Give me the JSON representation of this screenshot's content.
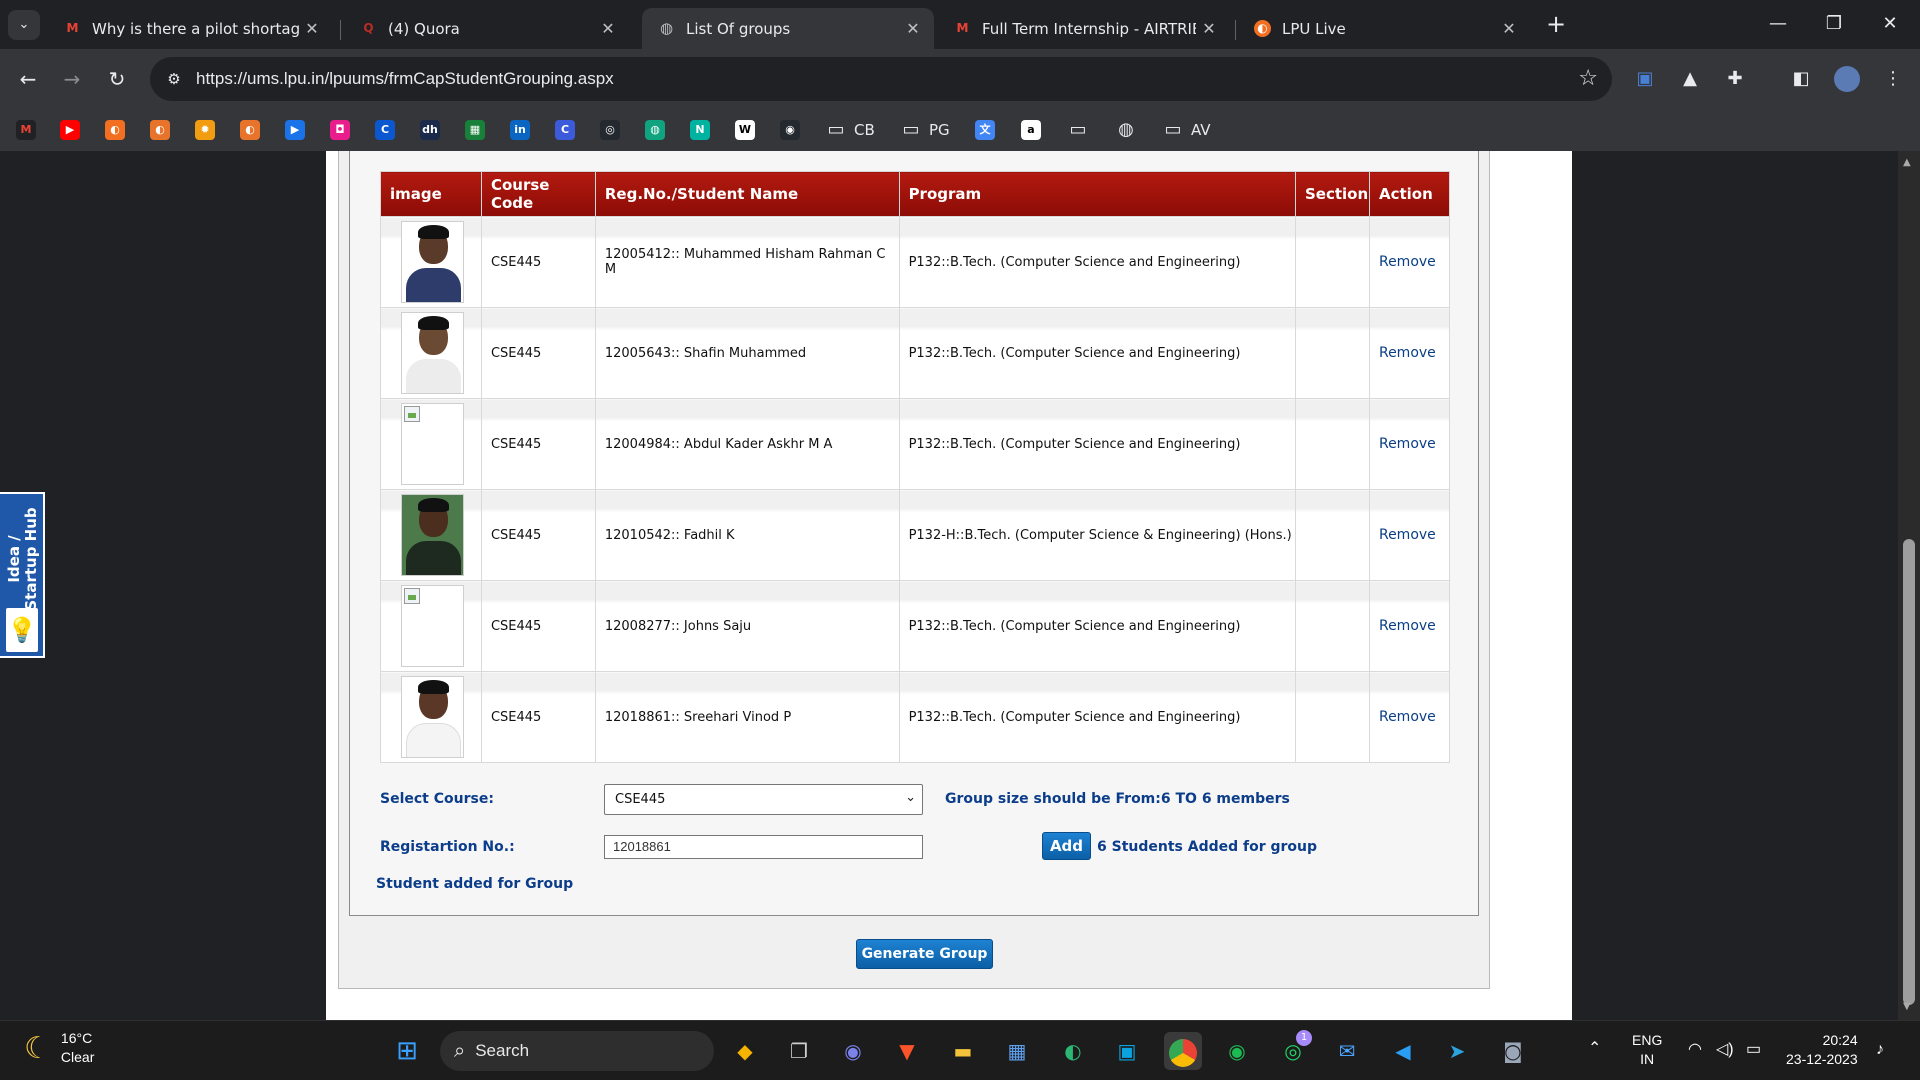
{
  "browser": {
    "tabs": [
      {
        "title": "Why is there a pilot shortage w",
        "favicon": "gmail-icon",
        "active": false
      },
      {
        "title": "(4) Quora",
        "favicon": "quora-icon",
        "active": false
      },
      {
        "title": "List Of groups",
        "favicon": "globe-icon",
        "active": true
      },
      {
        "title": "Full Term Internship - AIRTRIBE",
        "favicon": "gmail-icon",
        "active": false
      },
      {
        "title": "LPU Live",
        "favicon": "lpu-icon",
        "active": false
      }
    ],
    "url": "https://ums.lpu.in/lpuums/frmCapStudentGrouping.aspx",
    "bookmarks": [
      {
        "label": "",
        "icon": "gmail-icon",
        "color": "#202124",
        "glyph": "M"
      },
      {
        "label": "",
        "icon": "youtube-icon",
        "color": "#ff0000",
        "glyph": "▶"
      },
      {
        "label": "",
        "icon": "lpu-icon",
        "color": "#f26f21",
        "glyph": "◐"
      },
      {
        "label": "",
        "icon": "lpu-icon",
        "color": "#e8732a",
        "glyph": "◐"
      },
      {
        "label": "",
        "icon": "sun-icon",
        "color": "#f29c11",
        "glyph": "✹"
      },
      {
        "label": "",
        "icon": "lpu-icon",
        "color": "#e8732a",
        "glyph": "◐"
      },
      {
        "label": "",
        "icon": "play-icon",
        "color": "#1a73e8",
        "glyph": "▶"
      },
      {
        "label": "",
        "icon": "app-icon",
        "color": "#e91e8c",
        "glyph": "◘"
      },
      {
        "label": "",
        "icon": "c-icon",
        "color": "#0b57d0",
        "glyph": "C"
      },
      {
        "label": "",
        "icon": "dh-icon",
        "color": "#1b2a4a",
        "glyph": "dh"
      },
      {
        "label": "",
        "icon": "sheets-icon",
        "color": "#188038",
        "glyph": "▦"
      },
      {
        "label": "",
        "icon": "linkedin-icon",
        "color": "#0a66c2",
        "glyph": "in"
      },
      {
        "label": "",
        "icon": "c-circle-icon",
        "color": "#3b5bdb",
        "glyph": "C"
      },
      {
        "label": "",
        "icon": "github-alt-icon",
        "color": "#24292f",
        "glyph": "◎"
      },
      {
        "label": "",
        "icon": "chatgpt-icon",
        "color": "#10a37f",
        "glyph": "◍"
      },
      {
        "label": "",
        "icon": "n-icon",
        "color": "#00b3a1",
        "glyph": "N"
      },
      {
        "label": "",
        "icon": "wikipedia-icon",
        "color": "#ffffff",
        "glyph": "W"
      },
      {
        "label": "",
        "icon": "github-icon",
        "color": "#24292f",
        "glyph": "◉"
      },
      {
        "label": "CB",
        "icon": "folder-icon",
        "color": "",
        "glyph": "▭"
      },
      {
        "label": "PG",
        "icon": "folder-icon",
        "color": "",
        "glyph": "▭"
      },
      {
        "label": "",
        "icon": "translate-icon",
        "color": "#4285f4",
        "glyph": "文"
      },
      {
        "label": "",
        "icon": "amazon-icon",
        "color": "#ffffff",
        "glyph": "a"
      },
      {
        "label": "",
        "icon": "folder-icon",
        "color": "",
        "glyph": "▭"
      },
      {
        "label": "",
        "icon": "globe-icon",
        "color": "",
        "glyph": "◍"
      },
      {
        "label": "AV",
        "icon": "folder-icon",
        "color": "",
        "glyph": "▭"
      }
    ]
  },
  "table": {
    "headers": [
      "image",
      "Course Code",
      "Reg.No./Student Name",
      "Program",
      "Section",
      "Action"
    ],
    "rows": [
      {
        "photo": "student-photo",
        "course": "CSE445",
        "student": "12005412:: Muhammed Hisham Rahman C M",
        "program": "P132::B.Tech. (Computer Science and Engineering)",
        "section": "",
        "action": "Remove"
      },
      {
        "photo": "student-photo",
        "course": "CSE445",
        "student": "12005643:: Shafin Muhammed",
        "program": "P132::B.Tech. (Computer Science and Engineering)",
        "section": "",
        "action": "Remove"
      },
      {
        "photo": "broken-image",
        "course": "CSE445",
        "student": "12004984:: Abdul Kader Askhr M A",
        "program": "P132::B.Tech. (Computer Science and Engineering)",
        "section": "",
        "action": "Remove"
      },
      {
        "photo": "student-photo",
        "course": "CSE445",
        "student": "12010542:: Fadhil K",
        "program": "P132-H::B.Tech. (Computer Science & Engineering) (Hons.)",
        "section": "",
        "action": "Remove"
      },
      {
        "photo": "broken-image",
        "course": "CSE445",
        "student": "12008277:: Johns Saju",
        "program": "P132::B.Tech. (Computer Science and Engineering)",
        "section": "",
        "action": "Remove"
      },
      {
        "photo": "student-photo",
        "course": "CSE445",
        "student": "12018861:: Sreehari Vinod P",
        "program": "P132::B.Tech. (Computer Science and Engineering)",
        "section": "",
        "action": "Remove"
      }
    ]
  },
  "form": {
    "select_course_label": "Select Course:",
    "select_course_value": "CSE445",
    "group_size_note": "Group size should be From:6 TO 6 members",
    "registration_label": "Registartion No.:",
    "registration_value": "12018861",
    "add_label": "Add",
    "added_count_text": "6 Students Added for group",
    "student_added_text": "Student added for Group",
    "generate_label": "Generate Group"
  },
  "side_widget": {
    "label": "Idea / Startup Hub"
  },
  "taskbar": {
    "temperature": "16°C",
    "condition": "Clear",
    "search_placeholder": "Search",
    "language": "ENG",
    "region": "IN",
    "time": "20:24",
    "date": "23-12-2023",
    "whatsapp_badge": "1"
  },
  "colors": {
    "header_red": "#9d140b",
    "link_blue": "#0a3e86",
    "button_blue": "#1874c2"
  }
}
